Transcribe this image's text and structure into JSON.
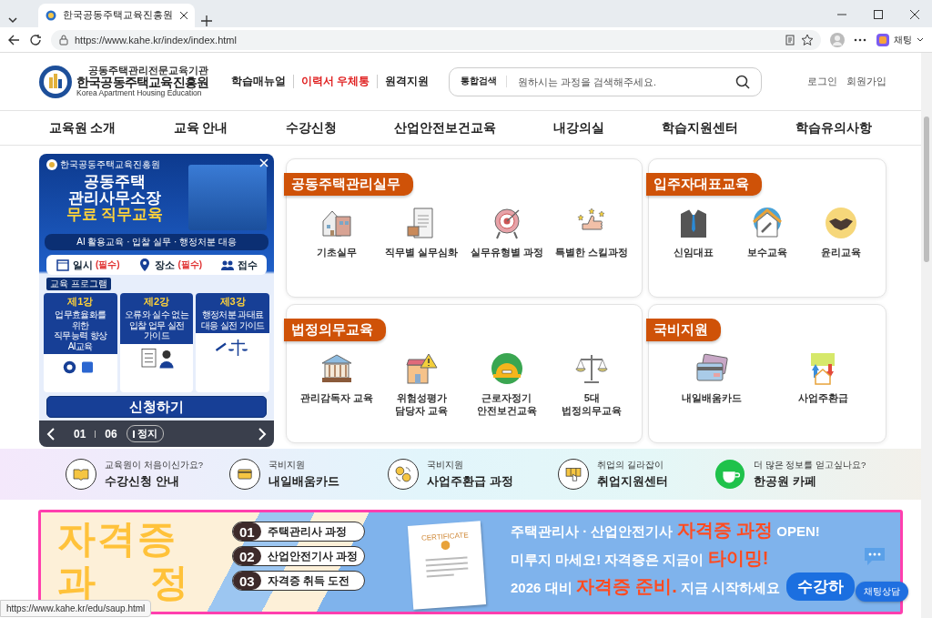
{
  "browser": {
    "tab_title": "한국공동주택교육진흥원",
    "url": "https://www.kahe.kr/index/index.html",
    "profile_label": "채팅",
    "status_url": "https://www.kahe.kr/edu/saup.html"
  },
  "header": {
    "logo_top": "공동주택관리전문교육기관",
    "logo_name": "한국공동주택교육진흥원",
    "logo_en": "Korea Apartment Housing Education",
    "links": [
      {
        "label": "학습매뉴얼",
        "highlight": false
      },
      {
        "label": "이력서 우체통",
        "highlight": true
      },
      {
        "label": "원격지원",
        "highlight": false
      }
    ],
    "search": {
      "label": "통합검색",
      "placeholder": "원하시는 과정을 검색해주세요."
    },
    "account": [
      "로그인",
      "회원가입"
    ]
  },
  "nav": [
    "교육원 소개",
    "교육 안내",
    "수강신청",
    "산업안전보건교육",
    "내강의실",
    "학습지원센터",
    "학습유의사항"
  ],
  "popup": {
    "org": "한국공동주택교육진흥원",
    "headline": [
      "공동주택",
      "관리사무소장",
      "무료 직무교육"
    ],
    "tagline": "AI 활용교육 · 입찰 실무 · 행정처분 대응",
    "info": [
      {
        "label": "일시",
        "note": "(필수)"
      },
      {
        "label": "장소",
        "note": "(필수)"
      },
      {
        "label": "접수"
      }
    ],
    "program_label": "교육 프로그램",
    "sessions": [
      {
        "title": "제1강",
        "desc": "업무효율화를 위한\n직무능력 향상 AI교육"
      },
      {
        "title": "제2강",
        "desc": "오류와 실수 없는\n입찰 업무 실전 가이드"
      },
      {
        "title": "제3강",
        "desc": "행정처분 과태료\n대응 실전 가이드"
      }
    ],
    "apply": "신청하기",
    "pager": {
      "current": "01",
      "total": "06",
      "pause": "정지"
    }
  },
  "categories": [
    {
      "title": "공동주택관리실무",
      "items": [
        "기초실무",
        "직무별 실무심화",
        "실무유형별 과정",
        "특별한 스킬과정"
      ]
    },
    {
      "title": "입주자대표교육",
      "items": [
        "신임대표",
        "보수교육",
        "윤리교육"
      ]
    },
    {
      "title": "법정의무교육",
      "items": [
        "관리감독자 교육",
        "위험성평가\n담당자 교육",
        "근로자정기\n안전보건교육",
        "5대\n법정의무교육"
      ]
    },
    {
      "title": "국비지원",
      "items": [
        "내일배움카드",
        "사업주환급"
      ]
    }
  ],
  "quick_links": [
    {
      "caption": "교육원이 처음이신가요?",
      "title": "수강신청 안내"
    },
    {
      "caption": "국비지원",
      "title": "내일배움카드"
    },
    {
      "caption": "국비지원",
      "title": "사업주환급 과정"
    },
    {
      "caption": "취업의 길라잡이",
      "title": "취업지원센터"
    },
    {
      "caption": "더 많은 정보를 얻고싶나요?",
      "title": "한공원 카페"
    }
  ],
  "cert_banner": {
    "title_top": "자격증",
    "title_bottom": "과 정",
    "steps": [
      {
        "num": "01",
        "label": "주택관리사 과정"
      },
      {
        "num": "02",
        "label": "산업안전기사 과정"
      },
      {
        "num": "03",
        "label": "자격증 취득 도전"
      }
    ],
    "certificate": "CERTIFICATE",
    "lines": [
      "주택관리사 · 산업안전기사 **자격증 과정** OPEN!",
      "미루지 마세요! 자격증은 지금이 **타이밍!**",
      "2026 대비 **자격증 준비.** 지금 시작하세요"
    ],
    "cta": "수강하"
  },
  "chat_button": "채팅상담"
}
